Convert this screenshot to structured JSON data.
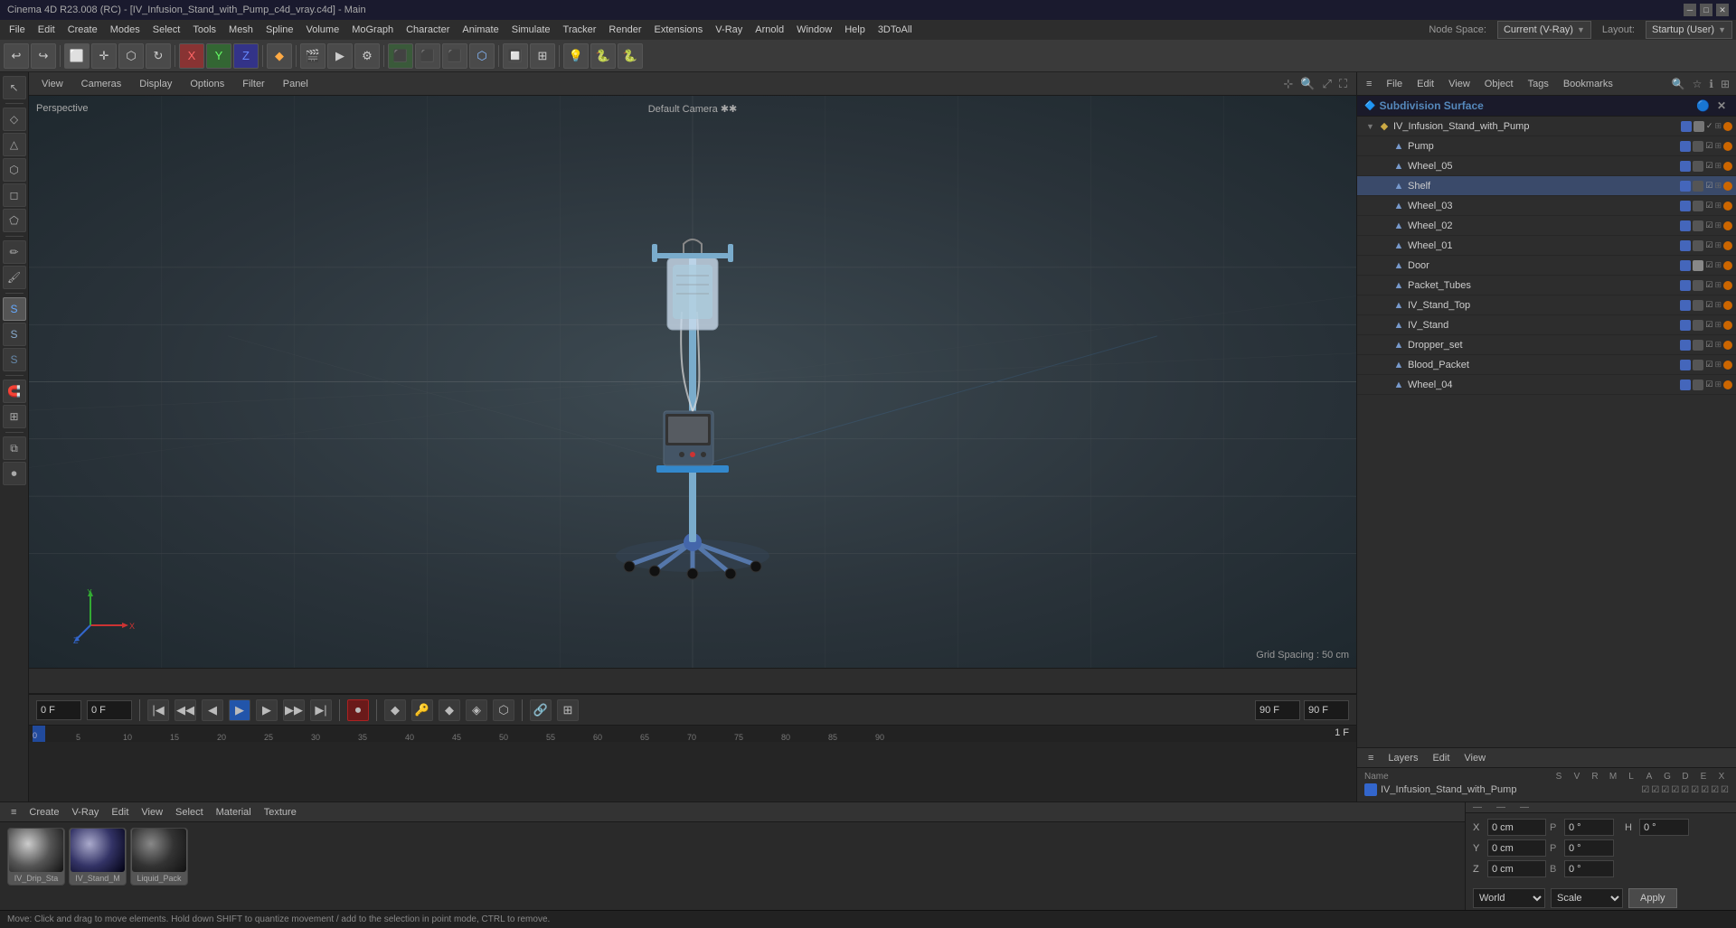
{
  "titleBar": {
    "title": "Cinema 4D R23.008 (RC) - [IV_Infusion_Stand_with_Pump_c4d_vray.c4d] - Main",
    "minimize": "─",
    "maximize": "□",
    "close": "✕"
  },
  "menuBar": {
    "items": [
      "File",
      "Edit",
      "Create",
      "Modes",
      "Select",
      "Tools",
      "Mesh",
      "Spline",
      "Volume",
      "MoGraph",
      "Character",
      "Animate",
      "Simulate",
      "Tracker",
      "Render",
      "Extensions",
      "V-Ray",
      "Arnold",
      "Window",
      "Help",
      "3DToAll"
    ]
  },
  "topToolbar": {
    "nodeSpaceLabel": "Node Space:",
    "nodeSpaceValue": "Current (V-Ray)",
    "layoutLabel": "Layout:",
    "layoutValue": "Startup (User)"
  },
  "viewport": {
    "menuItems": [
      "View",
      "Cameras",
      "Display",
      "Options",
      "Filter",
      "Panel"
    ],
    "cameraLabel": "Default Camera ✱✱",
    "perspLabel": "Perspective",
    "gridLabel": "Grid Spacing : 50 cm"
  },
  "objectTree": {
    "headerTitle": "Subdivision Surface",
    "items": [
      {
        "name": "IV_Infusion_Stand_with_Pump",
        "level": 1,
        "icon": "▶",
        "expanded": true
      },
      {
        "name": "Pump",
        "level": 2,
        "icon": "▲"
      },
      {
        "name": "Wheel_05",
        "level": 2,
        "icon": "▲"
      },
      {
        "name": "Shelf",
        "level": 2,
        "icon": "▲"
      },
      {
        "name": "Wheel_03",
        "level": 2,
        "icon": "▲"
      },
      {
        "name": "Wheel_02",
        "level": 2,
        "icon": "▲"
      },
      {
        "name": "Wheel_01",
        "level": 2,
        "icon": "▲"
      },
      {
        "name": "Door",
        "level": 2,
        "icon": "▲"
      },
      {
        "name": "Packet_Tubes",
        "level": 2,
        "icon": "▲"
      },
      {
        "name": "IV_Stand_Top",
        "level": 2,
        "icon": "▲"
      },
      {
        "name": "IV_Stand",
        "level": 2,
        "icon": "▲"
      },
      {
        "name": "Dropper_set",
        "level": 2,
        "icon": "▲"
      },
      {
        "name": "Blood_Packet",
        "level": 2,
        "icon": "▲"
      },
      {
        "name": "Wheel_04",
        "level": 2,
        "icon": "▲"
      }
    ]
  },
  "rightPanelToolbar": {
    "items": [
      "File",
      "Edit",
      "View",
      "Object",
      "Tags",
      "Bookmarks"
    ]
  },
  "layers": {
    "toolbarItems": [
      "Layers",
      "Edit",
      "View"
    ],
    "headerCols": [
      "Name",
      "S",
      "V",
      "R",
      "M",
      "L",
      "A",
      "G",
      "D",
      "E",
      "X"
    ],
    "row": {
      "name": "IV_Infusion_Stand_with_Pump"
    }
  },
  "timeline": {
    "startFrame": "0 F",
    "endFrame": "90 F",
    "currentFrame": "1 F",
    "markers": [
      "0",
      "5",
      "10",
      "15",
      "20",
      "25",
      "30",
      "35",
      "40",
      "45",
      "50",
      "55",
      "60",
      "65",
      "70",
      "75",
      "80",
      "85",
      "90"
    ],
    "timeInputStart": "0 F",
    "timeInputEnd": "90 F",
    "playhead": "0 F",
    "playheadEnd": "0 F"
  },
  "materials": {
    "toolbarItems": [
      "Create",
      "V-Ray",
      "Edit",
      "View",
      "Select",
      "Material",
      "Texture"
    ],
    "items": [
      {
        "label": "IV_Drip_Sta"
      },
      {
        "label": "IV_Stand_M"
      },
      {
        "label": "Liquid_Pack"
      }
    ]
  },
  "coordinates": {
    "x": {
      "label": "X",
      "val": "0 cm",
      "sym": "P",
      "val2": "0 °"
    },
    "y": {
      "label": "Y",
      "val": "0 cm",
      "sym": "P",
      "val2": "0 °"
    },
    "z": {
      "label": "Z",
      "val": "0 cm",
      "sym": "B",
      "val2": "0 °"
    },
    "h": {
      "label": "H",
      "val": "0 °"
    },
    "space": "World",
    "mode": "Scale",
    "applyBtn": "Apply",
    "worldOption": "World"
  },
  "statusBar": {
    "text": "Move: Click and drag to move elements. Hold down SHIFT to quantize movement / add to the selection in point mode, CTRL to remove."
  }
}
